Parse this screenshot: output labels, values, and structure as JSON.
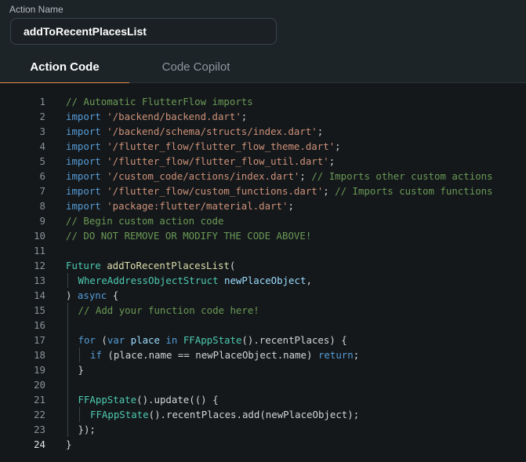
{
  "action_name": {
    "label": "Action Name",
    "value": "addToRecentPlacesList"
  },
  "tabs": [
    {
      "label": "Action Code",
      "active": true
    },
    {
      "label": "Code Copilot",
      "active": false
    }
  ],
  "editor": {
    "active_line": 24,
    "lines": [
      {
        "n": "1",
        "indent": 0,
        "tokens": [
          {
            "t": "// Automatic FlutterFlow imports",
            "c": "cmt"
          }
        ]
      },
      {
        "n": "2",
        "indent": 0,
        "tokens": [
          {
            "t": "import ",
            "c": "kw"
          },
          {
            "t": "'/backend/backend.dart'",
            "c": "str"
          },
          {
            "t": ";",
            "c": "plain"
          }
        ]
      },
      {
        "n": "3",
        "indent": 0,
        "tokens": [
          {
            "t": "import ",
            "c": "kw"
          },
          {
            "t": "'/backend/schema/structs/index.dart'",
            "c": "str"
          },
          {
            "t": ";",
            "c": "plain"
          }
        ]
      },
      {
        "n": "4",
        "indent": 0,
        "tokens": [
          {
            "t": "import ",
            "c": "kw"
          },
          {
            "t": "'/flutter_flow/flutter_flow_theme.dart'",
            "c": "str"
          },
          {
            "t": ";",
            "c": "plain"
          }
        ]
      },
      {
        "n": "5",
        "indent": 0,
        "tokens": [
          {
            "t": "import ",
            "c": "kw"
          },
          {
            "t": "'/flutter_flow/flutter_flow_util.dart'",
            "c": "str"
          },
          {
            "t": ";",
            "c": "plain"
          }
        ]
      },
      {
        "n": "6",
        "indent": 0,
        "tokens": [
          {
            "t": "import ",
            "c": "kw"
          },
          {
            "t": "'/custom_code/actions/index.dart'",
            "c": "str"
          },
          {
            "t": "; ",
            "c": "plain"
          },
          {
            "t": "// Imports other custom actions",
            "c": "cmt"
          }
        ]
      },
      {
        "n": "7",
        "indent": 0,
        "tokens": [
          {
            "t": "import ",
            "c": "kw"
          },
          {
            "t": "'/flutter_flow/custom_functions.dart'",
            "c": "str"
          },
          {
            "t": "; ",
            "c": "plain"
          },
          {
            "t": "// Imports custom functions",
            "c": "cmt"
          }
        ]
      },
      {
        "n": "8",
        "indent": 0,
        "tokens": [
          {
            "t": "import ",
            "c": "kw"
          },
          {
            "t": "'package:flutter/material.dart'",
            "c": "str"
          },
          {
            "t": ";",
            "c": "plain"
          }
        ]
      },
      {
        "n": "9",
        "indent": 0,
        "tokens": [
          {
            "t": "// Begin custom action code",
            "c": "cmt"
          }
        ]
      },
      {
        "n": "10",
        "indent": 0,
        "tokens": [
          {
            "t": "// DO NOT REMOVE OR MODIFY THE CODE ABOVE!",
            "c": "cmt"
          }
        ]
      },
      {
        "n": "11",
        "indent": 0,
        "tokens": []
      },
      {
        "n": "12",
        "indent": 0,
        "tokens": [
          {
            "t": "Future ",
            "c": "type"
          },
          {
            "t": "addToRecentPlacesList",
            "c": "fn"
          },
          {
            "t": "(",
            "c": "plain"
          }
        ]
      },
      {
        "n": "13",
        "indent": 1,
        "tokens": [
          {
            "t": "WhereAddressObjectStruct ",
            "c": "type"
          },
          {
            "t": "newPlaceObject",
            "c": "var"
          },
          {
            "t": ",",
            "c": "plain"
          }
        ]
      },
      {
        "n": "14",
        "indent": 0,
        "tokens": [
          {
            "t": ") ",
            "c": "plain"
          },
          {
            "t": "async",
            "c": "kw"
          },
          {
            "t": " {",
            "c": "plain"
          }
        ]
      },
      {
        "n": "15",
        "indent": 1,
        "tokens": [
          {
            "t": "// Add your function code here!",
            "c": "cmt"
          }
        ]
      },
      {
        "n": "16",
        "indent": 1,
        "tokens": []
      },
      {
        "n": "17",
        "indent": 1,
        "tokens": [
          {
            "t": "for",
            "c": "kw"
          },
          {
            "t": " (",
            "c": "plain"
          },
          {
            "t": "var",
            "c": "kw"
          },
          {
            "t": " place ",
            "c": "var"
          },
          {
            "t": "in",
            "c": "kw"
          },
          {
            "t": " ",
            "c": "plain"
          },
          {
            "t": "FFAppState",
            "c": "type"
          },
          {
            "t": "().recentPlaces) {",
            "c": "plain"
          }
        ]
      },
      {
        "n": "18",
        "indent": 2,
        "tokens": [
          {
            "t": "if",
            "c": "kw"
          },
          {
            "t": " (place.name == newPlaceObject.name) ",
            "c": "plain"
          },
          {
            "t": "return",
            "c": "kw"
          },
          {
            "t": ";",
            "c": "plain"
          }
        ]
      },
      {
        "n": "19",
        "indent": 1,
        "tokens": [
          {
            "t": "}",
            "c": "plain"
          }
        ]
      },
      {
        "n": "20",
        "indent": 1,
        "tokens": []
      },
      {
        "n": "21",
        "indent": 1,
        "tokens": [
          {
            "t": "FFAppState",
            "c": "type"
          },
          {
            "t": "().update(() {",
            "c": "plain"
          }
        ]
      },
      {
        "n": "22",
        "indent": 2,
        "tokens": [
          {
            "t": "FFAppState",
            "c": "type"
          },
          {
            "t": "().recentPlaces.add(newPlaceObject);",
            "c": "plain"
          }
        ]
      },
      {
        "n": "23",
        "indent": 1,
        "tokens": [
          {
            "t": "});",
            "c": "plain"
          }
        ]
      },
      {
        "n": "24",
        "indent": 0,
        "tokens": [
          {
            "t": "}",
            "c": "plain"
          }
        ]
      }
    ]
  },
  "colors": {
    "accent": "#e38a4a",
    "comment": "#6a9955",
    "keyword": "#569cd6",
    "string": "#ce9178",
    "type": "#4ec9b0",
    "function": "#dcdcaa"
  }
}
